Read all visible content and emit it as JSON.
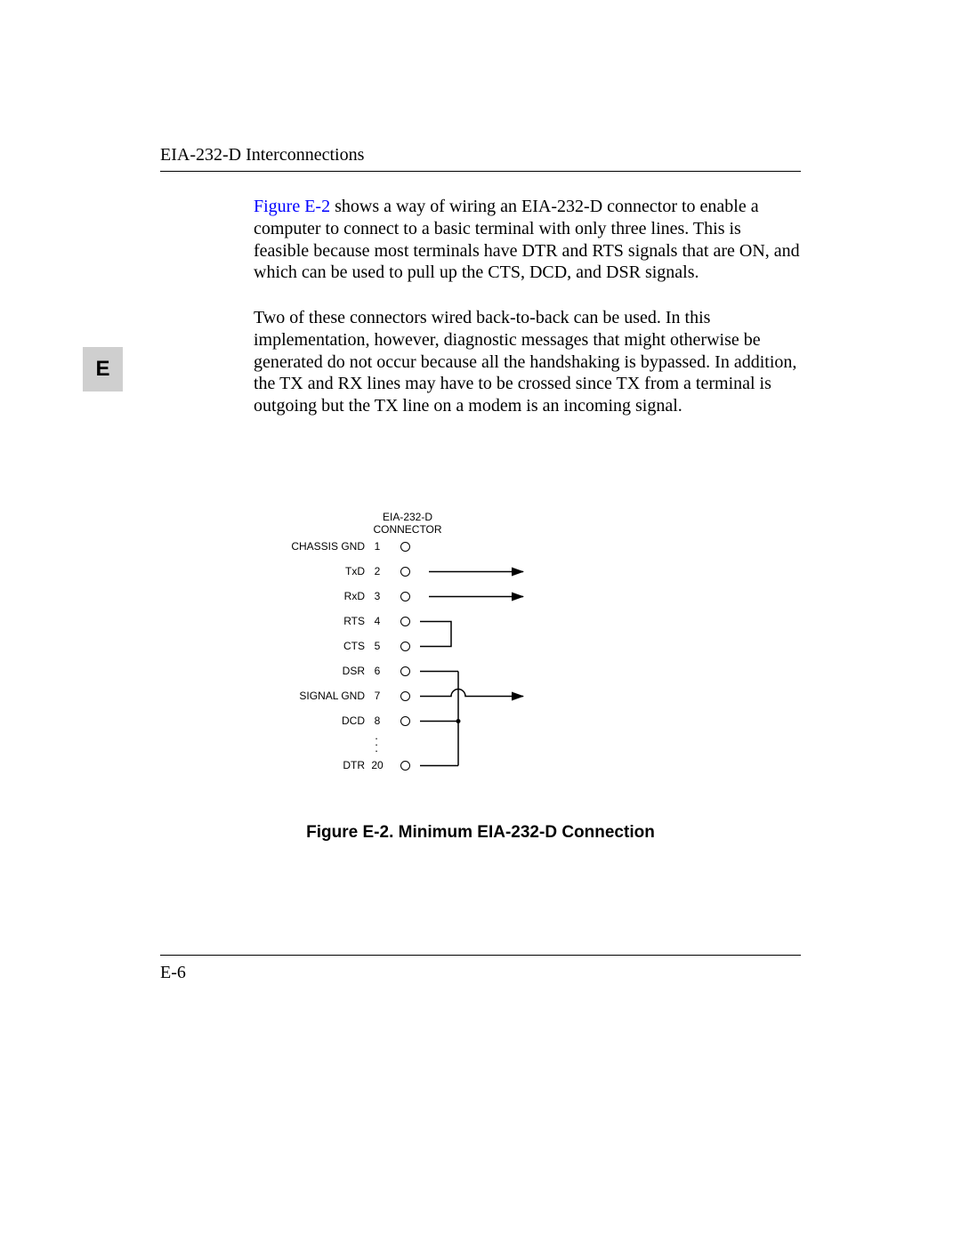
{
  "header": {
    "title": "EIA-232-D Interconnections"
  },
  "sideTab": "E",
  "para1": {
    "link": "Figure E-2",
    "rest": " shows a way of wiring an EIA-232-D connector to enable a computer to connect to a basic terminal with only three lines. This is feasible because most terminals have DTR and RTS signals that are ON, and which can be used to pull up the CTS, DCD, and DSR signals."
  },
  "para2": "Two of these connectors wired back-to-back can be used. In this implementation, however, diagnostic messages that might otherwise be generated do not occur because all the handshaking is bypassed. In addition, the TX and RX lines may have to be crossed since TX from a terminal is outgoing but the TX line on a modem is an incoming signal.",
  "diagram": {
    "title1": "EIA-232-D",
    "title2": "CONNECTOR",
    "pins": {
      "p1": {
        "label": "CHASSIS GND",
        "num": "1"
      },
      "p2": {
        "label": "TxD",
        "num": "2"
      },
      "p3": {
        "label": "RxD",
        "num": "3"
      },
      "p4": {
        "label": "RTS",
        "num": "4"
      },
      "p5": {
        "label": "CTS",
        "num": "5"
      },
      "p6": {
        "label": "DSR",
        "num": "6"
      },
      "p7": {
        "label": "SIGNAL GND",
        "num": "7"
      },
      "p8": {
        "label": "DCD",
        "num": "8"
      },
      "p20": {
        "label": "DTR",
        "num": "20"
      }
    }
  },
  "figureCaption": "Figure E-2.  Minimum EIA-232-D Connection",
  "footer": "E-6"
}
